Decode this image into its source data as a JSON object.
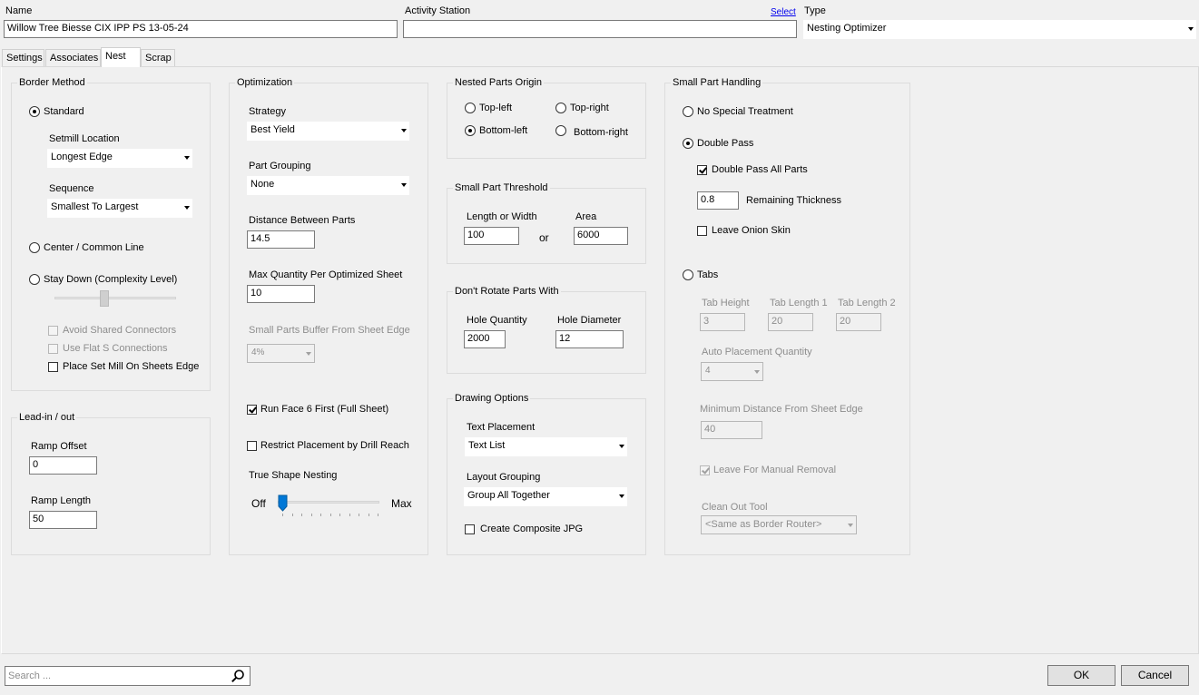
{
  "header": {
    "name_label": "Name",
    "name_value": "Willow Tree Biesse CIX IPP PS 13-05-24",
    "activity_label": "Activity Station",
    "select_link": "Select",
    "activity_value": "",
    "type_label": "Type",
    "type_value": "Nesting Optimizer"
  },
  "tabs": [
    "Settings",
    "Associates",
    "Nest",
    "Scrap"
  ],
  "active_tab": "Nest",
  "border_method": {
    "title": "Border Method",
    "standard": "Standard",
    "setmill_label": "Setmill Location",
    "setmill_value": "Longest Edge",
    "sequence_label": "Sequence",
    "sequence_value": "Smallest To Largest",
    "center": "Center / Common Line",
    "stay_down": "Stay Down (Complexity Level)",
    "avoid_shared": "Avoid Shared Connectors",
    "use_flat": "Use Flat S Connections",
    "place_set_mill": "Place Set Mill On Sheets Edge",
    "selected": "Standard"
  },
  "lead_in": {
    "title": "Lead-in / out",
    "ramp_offset_label": "Ramp Offset",
    "ramp_offset_value": "0",
    "ramp_length_label": "Ramp Length",
    "ramp_length_value": "50"
  },
  "optimization": {
    "title": "Optimization",
    "strategy_label": "Strategy",
    "strategy_value": "Best Yield",
    "grouping_label": "Part Grouping",
    "grouping_value": "None",
    "distance_label": "Distance Between Parts",
    "distance_value": "14.5",
    "maxqty_label": "Max Quantity Per Optimized Sheet",
    "maxqty_value": "10",
    "buffer_label": "Small Parts Buffer From Sheet Edge",
    "buffer_value": "4%",
    "run_face6": "Run Face 6 First (Full Sheet)",
    "restrict": "Restrict Placement by Drill Reach",
    "true_shape_label": "True Shape Nesting",
    "slider_off": "Off",
    "slider_max": "Max",
    "true_shape_level": 0
  },
  "origin": {
    "title": "Nested Parts Origin",
    "top_left": "Top-left",
    "top_right": "Top-right",
    "bottom_left": "Bottom-left",
    "bottom_right": "Bottom-right",
    "selected": "Bottom-left"
  },
  "threshold": {
    "title": "Small Part Threshold",
    "length_label": "Length or Width",
    "length_value": "100",
    "or": "or",
    "area_label": "Area",
    "area_value": "6000"
  },
  "dont_rotate": {
    "title": "Don't Rotate Parts With",
    "hole_qty_label": "Hole Quantity",
    "hole_qty_value": "2000",
    "hole_dia_label": "Hole Diameter",
    "hole_dia_value": "12"
  },
  "drawing": {
    "title": "Drawing Options",
    "text_placement_label": "Text Placement",
    "text_placement_value": "Text List",
    "layout_grouping_label": "Layout Grouping",
    "layout_grouping_value": "Group All Together",
    "composite": "Create Composite JPG"
  },
  "small_part": {
    "title": "Small Part Handling",
    "no_special": "No Special Treatment",
    "double_pass": "Double Pass",
    "double_pass_all": "Double Pass All Parts",
    "remaining_value": "0.8",
    "remaining_label": "Remaining Thickness",
    "onion": "Leave Onion Skin",
    "tabs": "Tabs",
    "tab_height_label": "Tab Height",
    "tab_height_value": "3",
    "tab_len1_label": "Tab Length 1",
    "tab_len1_value": "20",
    "tab_len2_label": "Tab Length 2",
    "tab_len2_value": "20",
    "auto_qty_label": "Auto Placement Quantity",
    "auto_qty_value": "4",
    "min_dist_label": "Minimum Distance From Sheet Edge",
    "min_dist_value": "40",
    "leave_manual": "Leave For Manual Removal",
    "cleanout_label": "Clean Out Tool",
    "cleanout_value": "<Same as Border Router>",
    "selected": "Double Pass"
  },
  "footer": {
    "search_placeholder": "Search ...",
    "ok": "OK",
    "cancel": "Cancel"
  },
  "icons": {
    "search": "search-icon",
    "dropdown": "chevron-down-icon"
  }
}
